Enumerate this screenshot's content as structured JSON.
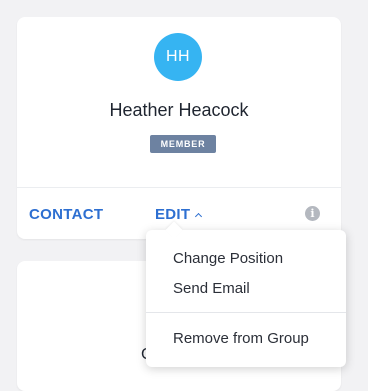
{
  "member_card": {
    "avatar_initials": "HH",
    "name": "Heather Heacock",
    "role_badge": "MEMBER",
    "contact_label": "CONTACT",
    "edit_label": "EDIT",
    "info_icon": "info-icon"
  },
  "second_card": {
    "partial_name": "Co"
  },
  "edit_menu": {
    "items": [
      {
        "label": "Change Position"
      },
      {
        "label": "Send Email"
      },
      {
        "label": "Remove from Group"
      }
    ]
  },
  "colors": {
    "avatar": "#36b4f2",
    "badge": "#6d82a1",
    "link": "#2d6fd1"
  }
}
